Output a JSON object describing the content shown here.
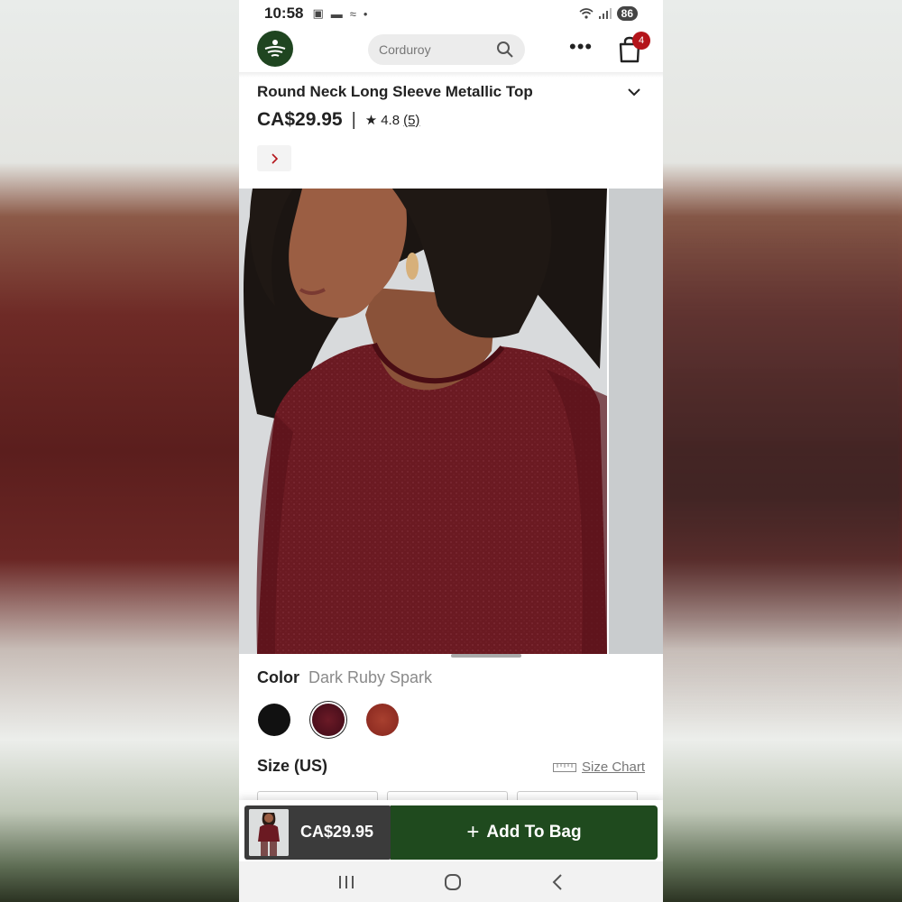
{
  "status_bar": {
    "time": "10:58",
    "battery": "86"
  },
  "header": {
    "search_placeholder": "Corduroy",
    "cart_count": "4"
  },
  "product": {
    "title": "Round Neck Long Sleeve Metallic Top",
    "price": "CA$29.95",
    "separator": "|",
    "rating": "4.8",
    "reviews": "(5)"
  },
  "color": {
    "label": "Color",
    "selected": "Dark Ruby Spark",
    "swatches": [
      {
        "name": "black",
        "hex": "#111111"
      },
      {
        "name": "dark-ruby-spark",
        "hex": "#4c0f1c",
        "selected": true
      },
      {
        "name": "rust",
        "hex": "#8e2c22"
      }
    ]
  },
  "size": {
    "label": "Size (US)",
    "chart_link": "Size Chart"
  },
  "sticky_bar": {
    "price": "CA$29.95",
    "add_button": "Add To Bag",
    "accent": "#1f4a1e"
  },
  "colors": {
    "brand_green": "#1f4520",
    "badge_red": "#b4141a"
  }
}
